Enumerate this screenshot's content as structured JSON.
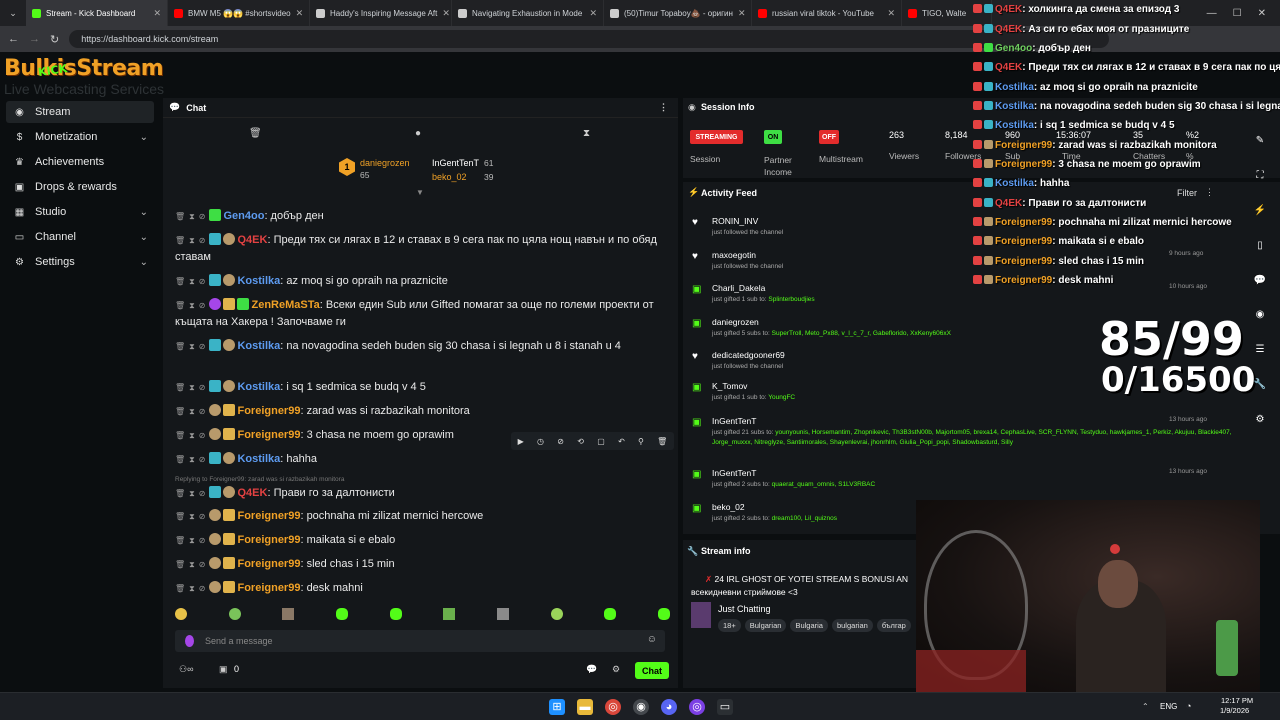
{
  "browser": {
    "tabs": [
      {
        "label": "Stream - Kick Dashboard",
        "color": "#53fc18"
      },
      {
        "label": "BMW M5 😱😱 #shortsvideo",
        "color": "#ff0000"
      },
      {
        "label": "Haddy's Inspiring Message Aft",
        "color": "#cccccc"
      },
      {
        "label": "Navigating Exhaustion in Mode",
        "color": "#cccccc"
      },
      {
        "label": "(50)Timur Topaboy💩 - оригин",
        "color": "#cccccc"
      },
      {
        "label": "russian viral tiktok - YouTube",
        "color": "#ff0000"
      },
      {
        "label": "TIGO, Walte",
        "color": "#ff0000"
      }
    ],
    "url": "https://dashboard.kick.com/stream"
  },
  "brand": {
    "logo_text": "BulkisStream",
    "kick_text": "KICK",
    "logo_sub": "Live Webcasting Services"
  },
  "nav": {
    "items": [
      {
        "label": "Stream",
        "icon": "broadcast-icon"
      },
      {
        "label": "Monetization",
        "icon": "dollar-icon"
      },
      {
        "label": "Achievements",
        "icon": "trophy-icon"
      },
      {
        "label": "Drops & rewards",
        "icon": "gift-icon"
      },
      {
        "label": "Studio",
        "icon": "studio-icon"
      },
      {
        "label": "Channel",
        "icon": "monitor-icon"
      },
      {
        "label": "Settings",
        "icon": "gear-icon"
      }
    ]
  },
  "chat": {
    "title": "Chat",
    "pinned": {
      "top_user": "daniegrozen",
      "top_count": "65",
      "user2": "InGentTenT",
      "user2_count": "61",
      "user3": "beko_02",
      "user3_count": "39",
      "rank": "1"
    },
    "messages": [
      {
        "name": "Gen4oo",
        "color": "#5d9bf0",
        "text": ": добър ден"
      },
      {
        "name": "Q4EK",
        "color": "#e34242",
        "text": ": Преди тях си лягах в 12 и ставах в 9 сега пак по цяла нощ навън и по обяд ставам"
      },
      {
        "name": "Kostilka",
        "color": "#5d9bf0",
        "text": ": az moq si go opraih na praznicite"
      },
      {
        "name": "ZenReMaSTa",
        "color": "#f0a126",
        "text": ": Всеки един Sub или Gifted помагат за още по големи проекти от къщата на Хакера ! Започваме ги"
      },
      {
        "name": "Kostilka",
        "color": "#5d9bf0",
        "text": ": na novagodina sedeh buden sig 30 chasa i si legnah u 8 i stanah u 4"
      },
      {
        "name": "Kostilka",
        "color": "#5d9bf0",
        "text": ": i sq 1 sedmica se budq v 4 5"
      },
      {
        "name": "Foreigner99",
        "color": "#f0a126",
        "text": ": zarad was si razbazikah monitora"
      },
      {
        "name": "Foreigner99",
        "color": "#f0a126",
        "text": ": 3 chasa ne moem go oprawim"
      },
      {
        "name": "Kostilka",
        "color": "#5d9bf0",
        "text": ": hahha"
      },
      {
        "name": "Q4EK",
        "color": "#e34242",
        "text": ": Прави го за далтонисти"
      },
      {
        "name": "Foreigner99",
        "color": "#f0a126",
        "text": ": pochnaha mi zilizat mernici hercowe"
      },
      {
        "name": "Foreigner99",
        "color": "#f0a126",
        "text": ": maikata si e ebalo"
      },
      {
        "name": "Foreigner99",
        "color": "#f0a126",
        "text": ": sled chas i 15 min"
      },
      {
        "name": "Foreigner99",
        "color": "#f0a126",
        "text": ": desk mahni"
      }
    ],
    "reply_note": "Replying to Foreigner99: zarad was si razbazikah monitora",
    "input_placeholder": "Send a message",
    "points": "0",
    "send_label": "Chat"
  },
  "session": {
    "title": "Session Info",
    "streaming_label": "STREAMING",
    "on_label": "ON",
    "off_label": "OFF",
    "session_label": "Session",
    "partner_label": "Partner Income",
    "multistream_label": "Multistream",
    "viewers_value": "263",
    "viewers_label": "Viewers",
    "followers_value": "8,184",
    "followers_label": "Followers",
    "subs_value": "960",
    "subs_label": "Sub",
    "time_value": "15:36:07",
    "time_label": "Time",
    "chatters_value": "35",
    "chatters_label": "Chatters",
    "pct_value": "%2",
    "pct_label": "%"
  },
  "activity": {
    "title": "Activity Feed",
    "filter_label": "Filter",
    "items": [
      {
        "name": "RONIN_INV",
        "desc": "just followed the channel",
        "extra": "",
        "time": "",
        "icon": "heart-icon"
      },
      {
        "name": "maxoegotin",
        "desc": "just followed the channel",
        "extra": "",
        "time": "9 hours ago",
        "icon": "heart-icon"
      },
      {
        "name": "Charli_Dakela",
        "desc": "just gifted 1 sub to:",
        "extra": "Splinterboudjies",
        "time": "10 hours ago",
        "icon": "gift-icon"
      },
      {
        "name": "daniegrozen",
        "desc": "just gifted 5 subs to:",
        "extra": "SuperTroll, Meto_Px88, v_l_c_7_r, Gabeflorido, XxKeny606xX",
        "time": "",
        "icon": "gift-icon"
      },
      {
        "name": "dedicatedgooner69",
        "desc": "just followed the channel",
        "extra": "",
        "time": "",
        "icon": "heart-icon"
      },
      {
        "name": "K_Tomov",
        "desc": "just gifted 1 sub to:",
        "extra": "YoungFC",
        "time": "",
        "icon": "gift-icon"
      },
      {
        "name": "InGentTenT",
        "desc": "just gifted 21 subs to:",
        "extra": "younyounis, Horsemantim, Zhopnikevic, Th3B3stN00b, Majortom05, brexa14, CephasLive, SCR_FLYNN, Testyduo, hawkjames_1, Perkiz, Akujuu, Blackie407, Jorge_muxxx, Nitreglyze, Santiimorales, Shayenlevrai, jhonrhlm, Giulia_Popi_popi, Shadowbasturd, Silly",
        "time": "13 hours ago",
        "icon": "gift-icon"
      },
      {
        "name": "InGentTenT",
        "desc": "just gifted 2 subs to:",
        "extra": "quaerat_quam_omnis, S1LV3RBAC",
        "time": "13 hours ago",
        "icon": "gift-icon"
      },
      {
        "name": "beko_02",
        "desc": "just gifted 2 subs to:",
        "extra": "dream100, Lil_quiznos",
        "time": "",
        "icon": "gift-icon"
      }
    ]
  },
  "stream_info": {
    "title": "Stream info",
    "stream_title": "24 IRL GHOST OF YOTEI STREAM S BONUSI AN",
    "stream_title2": "всекидневни стриймове <3",
    "category": "Just Chatting",
    "tags": [
      "18+",
      "Bulgarian",
      "Bulgaria",
      "bulgarian",
      "българ"
    ]
  },
  "overlay": {
    "messages": [
      {
        "name": "Q4EK",
        "color": "#e34242",
        "text": ": холкинга да смена за епизод 3"
      },
      {
        "name": "Q4EK",
        "color": "#e34242",
        "text": ": Аз си го ебах моя от празниците"
      },
      {
        "name": "Gen4oo",
        "color": "#6fcf5f",
        "text": ": добър ден"
      },
      {
        "name": "Q4EK",
        "color": "#e34242",
        "text": ": Преди тях си лягах в 12 и ставах в 9 сега пак по цяла"
      },
      {
        "name": "Kostilka",
        "color": "#5d9bf0",
        "text": ": az moq si go opraih na praznicite"
      },
      {
        "name": "Kostilka",
        "color": "#5d9bf0",
        "text": ": na novagodina sedeh buden sig 30 chasa i si legnah"
      },
      {
        "name": "Kostilka",
        "color": "#5d9bf0",
        "text": ": i sq 1 sedmica se budq v 4 5"
      },
      {
        "name": "Foreigner99",
        "color": "#f0a126",
        "text": ": zarad was si razbazikah monitora"
      },
      {
        "name": "Foreigner99",
        "color": "#f0a126",
        "text": ": 3 chasa ne moem go oprawim"
      },
      {
        "name": "Kostilka",
        "color": "#5d9bf0",
        "text": ": hahha"
      },
      {
        "name": "Q4EK",
        "color": "#e34242",
        "text": ": Прави го за далтонисти"
      },
      {
        "name": "Foreigner99",
        "color": "#f0a126",
        "text": ": pochnaha mi zilizat mernici hercowe"
      },
      {
        "name": "Foreigner99",
        "color": "#f0a126",
        "text": ": maikata si e ebalo"
      },
      {
        "name": "Foreigner99",
        "color": "#f0a126",
        "text": ": sled chas i 15 min"
      },
      {
        "name": "Foreigner99",
        "color": "#f0a126",
        "text": ": desk mahni"
      }
    ],
    "counter1": "85/99",
    "counter2": "0/16500"
  },
  "taskbar": {
    "lang": "ENG",
    "time": "12:17 PM",
    "date": "1/9/2026"
  }
}
